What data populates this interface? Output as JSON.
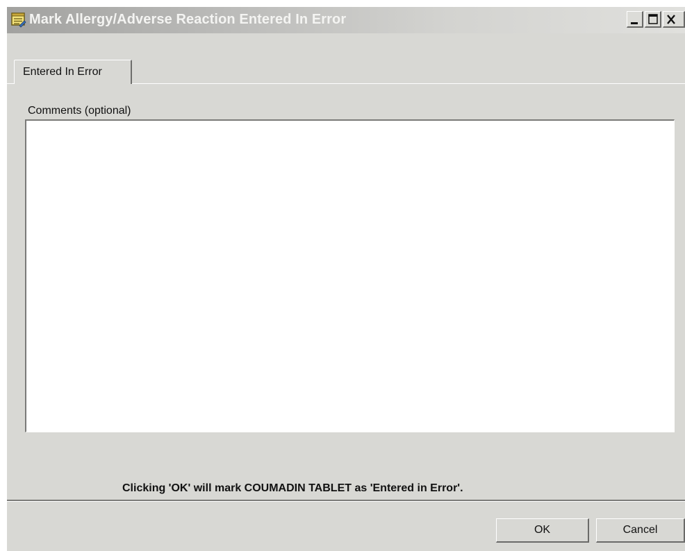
{
  "window": {
    "title": "Mark Allergy/Adverse Reaction Entered In Error",
    "icon": "form-icon",
    "controls": {
      "minimize": "_",
      "maximize": "□",
      "close": "X"
    }
  },
  "tabs": [
    {
      "label": "Entered In Error",
      "selected": true
    }
  ],
  "comments": {
    "label": "Comments (optional)",
    "value": ""
  },
  "notice": "Clicking 'OK' will mark COUMADIN TABLET as 'Entered in Error'.",
  "buttons": {
    "ok": "OK",
    "cancel": "Cancel"
  },
  "colors": {
    "window_bg": "#d8d8d4",
    "field_bg": "#ffffff",
    "title_text": "#f4f4f2"
  }
}
